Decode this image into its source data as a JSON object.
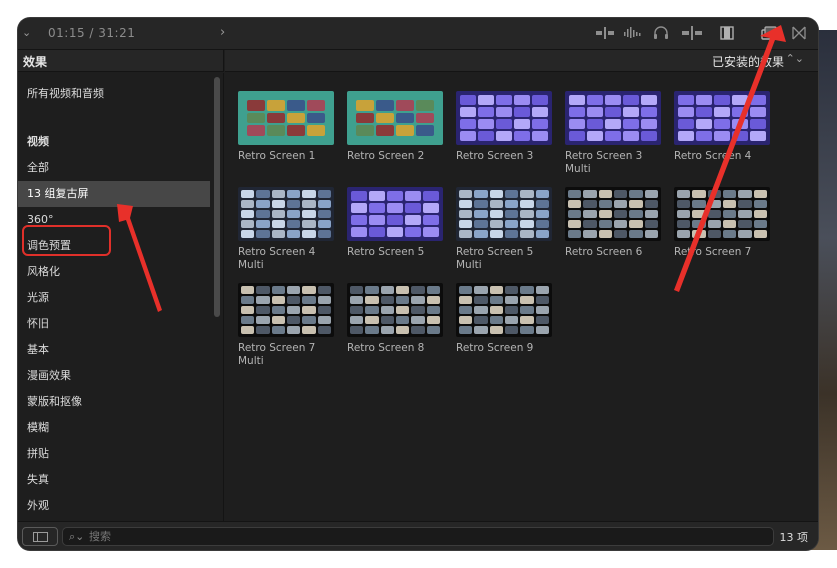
{
  "toolbar": {
    "timecode": "01:15 / 31:21",
    "icons": [
      "chevron-down-icon",
      "chevron-right-icon",
      "audio-meter-icon",
      "waveform-icon",
      "headphones-icon",
      "clip-skimming-icon",
      "filmstrip-icon",
      "browser-icon",
      "transitions-icon"
    ]
  },
  "sidebar": {
    "title": "效果",
    "items": [
      {
        "label": "所有视频和音频",
        "type": "item"
      },
      {
        "label": "视频",
        "type": "heading"
      },
      {
        "label": "全部",
        "type": "item"
      },
      {
        "label": "13 组复古屏",
        "type": "selected"
      },
      {
        "label": "360°",
        "type": "item"
      },
      {
        "label": "调色预置",
        "type": "item"
      },
      {
        "label": "风格化",
        "type": "item"
      },
      {
        "label": "光源",
        "type": "item"
      },
      {
        "label": "怀旧",
        "type": "item"
      },
      {
        "label": "基本",
        "type": "item"
      },
      {
        "label": "漫画效果",
        "type": "item"
      },
      {
        "label": "蒙版和抠像",
        "type": "item"
      },
      {
        "label": "模糊",
        "type": "item"
      },
      {
        "label": "拼贴",
        "type": "item"
      },
      {
        "label": "失真",
        "type": "item"
      },
      {
        "label": "外观",
        "type": "item"
      }
    ]
  },
  "browser": {
    "filter_label": "已安装的效果",
    "effects": [
      {
        "name": "Retro Screen 1",
        "style": "tv"
      },
      {
        "name": "Retro Screen 2",
        "style": "tv"
      },
      {
        "name": "Retro Screen 3",
        "style": "purple"
      },
      {
        "name": "Retro Screen 3 Multi",
        "style": "purple"
      },
      {
        "name": "Retro Screen 4",
        "style": "purple"
      },
      {
        "name": "Retro Screen 4 Multi",
        "style": "blue"
      },
      {
        "name": "Retro Screen 5",
        "style": "purple"
      },
      {
        "name": "Retro Screen 5 Multi",
        "style": "blue"
      },
      {
        "name": "Retro Screen 6",
        "style": "dark"
      },
      {
        "name": "Retro Screen 7",
        "style": "dark"
      },
      {
        "name": "Retro Screen 7 Multi",
        "style": "dark"
      },
      {
        "name": "Retro Screen 8",
        "style": "dark"
      },
      {
        "name": "Retro Screen 9",
        "style": "dark"
      }
    ]
  },
  "footer": {
    "search_placeholder": "搜索",
    "item_count": "13 项"
  },
  "colors": {
    "background": "#1e1e1e",
    "selection": "#474747",
    "annotation": "#e0302a"
  }
}
